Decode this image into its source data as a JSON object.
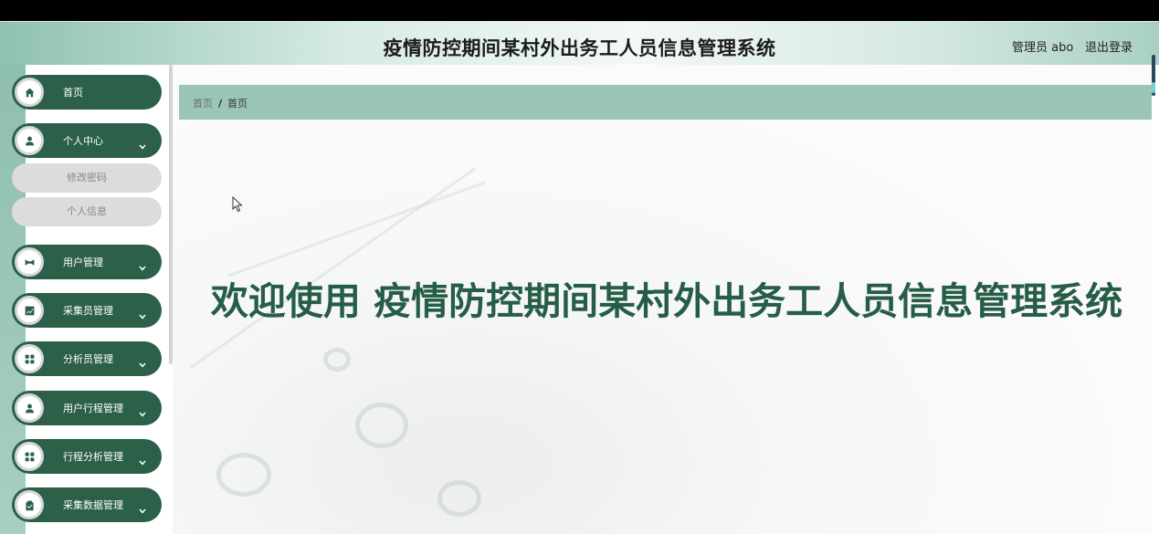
{
  "app": {
    "title": "疫情防控期间某村外出务工人员信息管理系统",
    "user_label": "管理员 abo",
    "logout_label": "退出登录"
  },
  "sidebar": {
    "items": [
      {
        "label": "首页",
        "icon": "home-icon",
        "has_children": false
      },
      {
        "label": "个人中心",
        "icon": "user-icon",
        "has_children": true,
        "children": [
          "修改密码",
          "个人信息"
        ]
      },
      {
        "label": "用户管理",
        "icon": "bowtie-icon",
        "has_children": true
      },
      {
        "label": "采集员管理",
        "icon": "chart-box-icon",
        "has_children": true
      },
      {
        "label": "分析员管理",
        "icon": "grid-icon",
        "has_children": true
      },
      {
        "label": "用户行程管理",
        "icon": "person-icon",
        "has_children": true
      },
      {
        "label": "行程分析管理",
        "icon": "grid-icon",
        "has_children": true
      },
      {
        "label": "采集数据管理",
        "icon": "clipboard-icon",
        "has_children": true
      }
    ]
  },
  "breadcrumb": {
    "home": "首页",
    "separator": "/",
    "current": "首页"
  },
  "main": {
    "welcome": "欢迎使用 疫情防控期间某村外出务工人员信息管理系统"
  },
  "colors": {
    "accent": "#2c6049",
    "breadcrumb_bg": "#9bc5b6",
    "welcome_text": "#265d47"
  }
}
